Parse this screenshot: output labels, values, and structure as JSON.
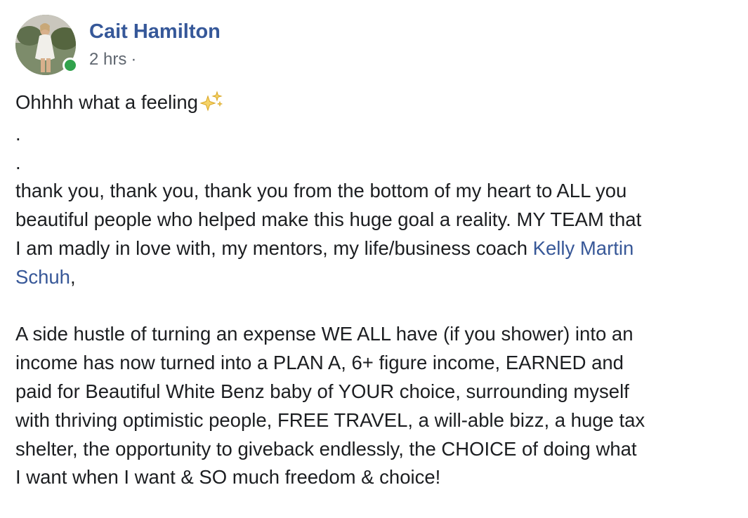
{
  "post": {
    "author": "Cait Hamilton",
    "timestamp": "2 hrs",
    "meta_separator": "·",
    "avatar_online": true,
    "colors": {
      "link": "#385898",
      "author": "#365899",
      "online": "#31a24c",
      "meta": "#606770"
    },
    "emoji": "sparkles-icon",
    "content": {
      "line1": "Ohhhh what a feeling",
      "dot1": ".",
      "dot2": ".",
      "p1_line1": "thank you, thank you, thank you from the bottom of my heart to ALL you",
      "p1_line2": "beautiful people who helped make this huge goal a reality. MY TEAM that",
      "p1_line3_pre": "I am madly in love with, my mentors, my life/business coach ",
      "mention_part1": "Kelly Martin",
      "mention_part2": "Schuh",
      "p1_line4_post": ",",
      "p2_line1": "A side hustle of turning an expense WE ALL have (if you shower) into an",
      "p2_line2": "income has now turned into a PLAN A, 6+ figure income, EARNED and",
      "p2_line3": "paid for Beautiful White Benz baby of YOUR choice, surrounding myself",
      "p2_line4": "with thriving optimistic people, FREE TRAVEL, a will-able bizz, a huge tax",
      "p2_line5": "shelter, the opportunity to giveback endlessly, the CHOICE of doing what",
      "p2_line6": "I want when I want & SO much freedom & choice!"
    }
  }
}
